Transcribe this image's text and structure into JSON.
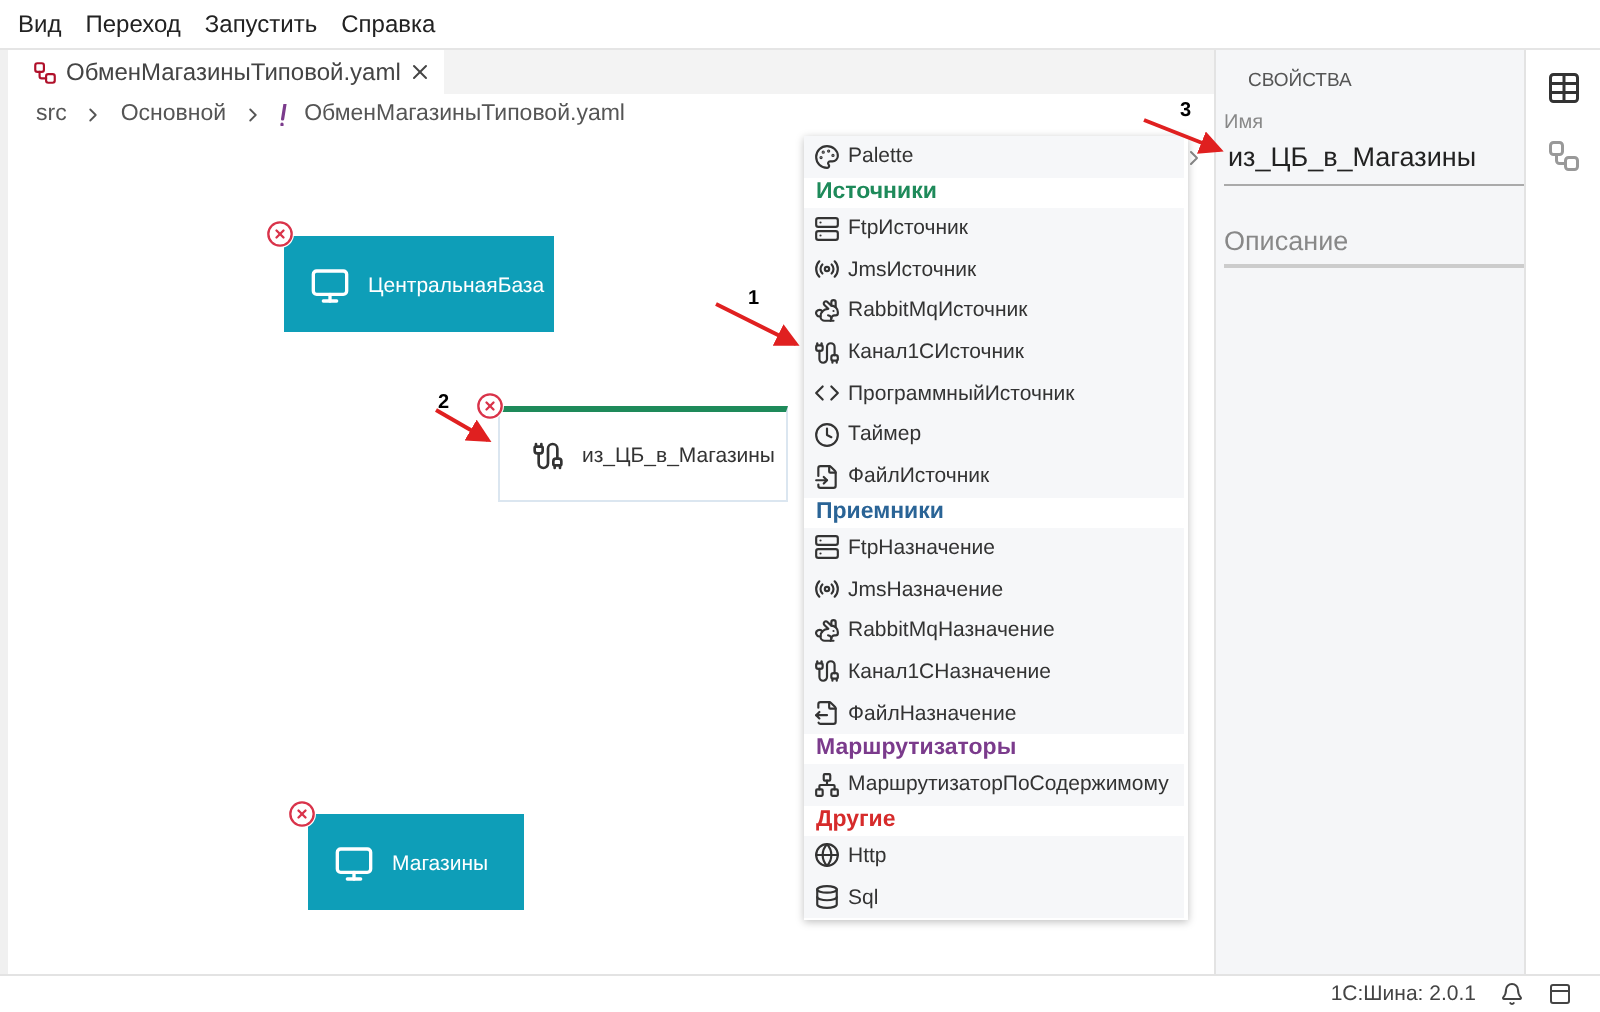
{
  "menu": [
    "Вид",
    "Переход",
    "Запустить",
    "Справка"
  ],
  "tabs": [
    {
      "label": "ОбменМагазиныТиповой.yaml",
      "selected": true
    }
  ],
  "breadcrumbs": [
    "src",
    "Основной",
    "ОбменМагазиныТиповой.yaml"
  ],
  "nodes": [
    {
      "kind": "endpoint",
      "label": "ЦентральнаяБаза",
      "selected": false
    },
    {
      "kind": "channel",
      "label": "из_ЦБ_в_Магазины",
      "selected": true
    },
    {
      "kind": "endpoint",
      "label": "Магазины",
      "selected": false
    }
  ],
  "palette": [
    {
      "kind": "item",
      "label": "Palette"
    },
    {
      "kind": "header",
      "label": "Источники",
      "color": "#1e8a5a"
    },
    {
      "kind": "item",
      "label": "FtpИсточник"
    },
    {
      "kind": "item",
      "label": "JmsИсточник"
    },
    {
      "kind": "item",
      "label": "RabbitMqИсточник"
    },
    {
      "kind": "item",
      "label": "Канал1СИсточник"
    },
    {
      "kind": "item",
      "label": "ПрограммныйИсточник"
    },
    {
      "kind": "item",
      "label": "Таймер"
    },
    {
      "kind": "item",
      "label": "ФайлИсточник"
    },
    {
      "kind": "header",
      "label": "Приемники",
      "color": "#2a6496"
    },
    {
      "kind": "item",
      "label": "FtpНазначение"
    },
    {
      "kind": "item",
      "label": "JmsНазначение"
    },
    {
      "kind": "item",
      "label": "RabbitMqНазначение"
    },
    {
      "kind": "item",
      "label": "Канал1СНазначение"
    },
    {
      "kind": "item",
      "label": "ФайлНазначение"
    },
    {
      "kind": "header",
      "label": "Маршрутизаторы",
      "color": "#7b3b8c"
    },
    {
      "kind": "item",
      "label": "МаршрутизаторПоСодержимому"
    },
    {
      "kind": "header",
      "label": "Другие",
      "color": "#d62b2b"
    },
    {
      "kind": "item",
      "label": "Http"
    },
    {
      "kind": "item",
      "label": "Sql"
    }
  ],
  "properties": {
    "title": "СВОЙСТВА",
    "name_label": "Имя",
    "name_value": "из_ЦБ_в_Магазины",
    "description_placeholder": "Описание"
  },
  "annotations": [
    "1",
    "2",
    "3"
  ],
  "status_bar": {
    "version": "1С:Шина: 2.0.1"
  }
}
